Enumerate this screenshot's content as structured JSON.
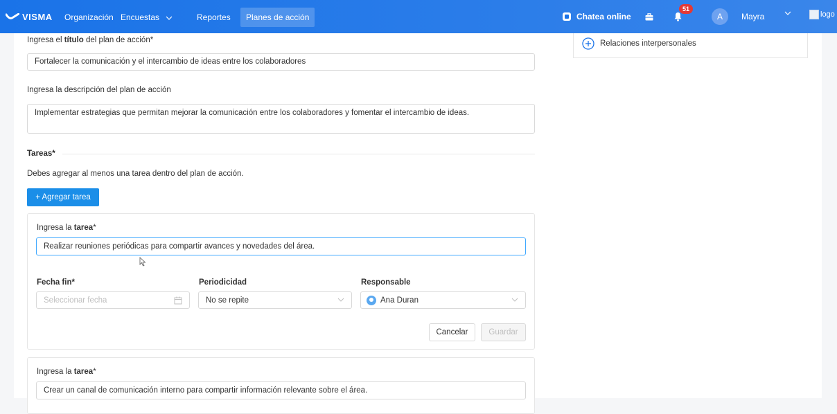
{
  "nav": {
    "brand": "VISMA",
    "items": [
      {
        "label": "Organización"
      },
      {
        "label": "Encuestas"
      },
      {
        "label": "Reportes"
      },
      {
        "label": "Planes de acción"
      }
    ],
    "chat_label": "Chatea online",
    "notification_count": "51",
    "avatar_initial": "A",
    "user_name": "Mayra",
    "logo_alt": "logo"
  },
  "sidebar": {
    "item_label": "Relaciones interpersonales"
  },
  "form": {
    "title_label_prefix": "Ingresa el ",
    "title_label_bold": "título",
    "title_label_suffix": " del plan de acción*",
    "title_value": "Fortalecer la comunicación y el intercambio de ideas entre los colaboradores",
    "description_label": "Ingresa la descripción del plan de acción",
    "description_value": "Implementar estrategias que permitan mejorar la comunicación entre los colaboradores y fomentar el intercambio de ideas.",
    "tasks_heading": "Tareas*",
    "tasks_hint": "Debes agregar al menos una tarea dentro del plan de acción.",
    "add_task_button": "+ Agregar tarea"
  },
  "task_cards": [
    {
      "label_prefix": "Ingresa la ",
      "label_bold": "tarea",
      "label_suffix": "*",
      "value": "Realizar reuniones periódicas para compartir avances y novedades del área.",
      "end_date_label": "Fecha fin*",
      "end_date_placeholder": "Seleccionar fecha",
      "periodicity_label": "Periodicidad",
      "periodicity_value": "No se repite",
      "owner_label": "Responsable",
      "owner_value": "Ana Duran",
      "cancel_button": "Cancelar",
      "save_button": "Guardar"
    },
    {
      "label_prefix": "Ingresa la ",
      "label_bold": "tarea",
      "label_suffix": "*",
      "value": "Crear un canal de comunicación interno para compartir información relevante sobre el área."
    }
  ],
  "colors": {
    "nav_blue": "#1a73e8",
    "primary_button": "#1b8ee8",
    "badge_red": "#e53935"
  }
}
